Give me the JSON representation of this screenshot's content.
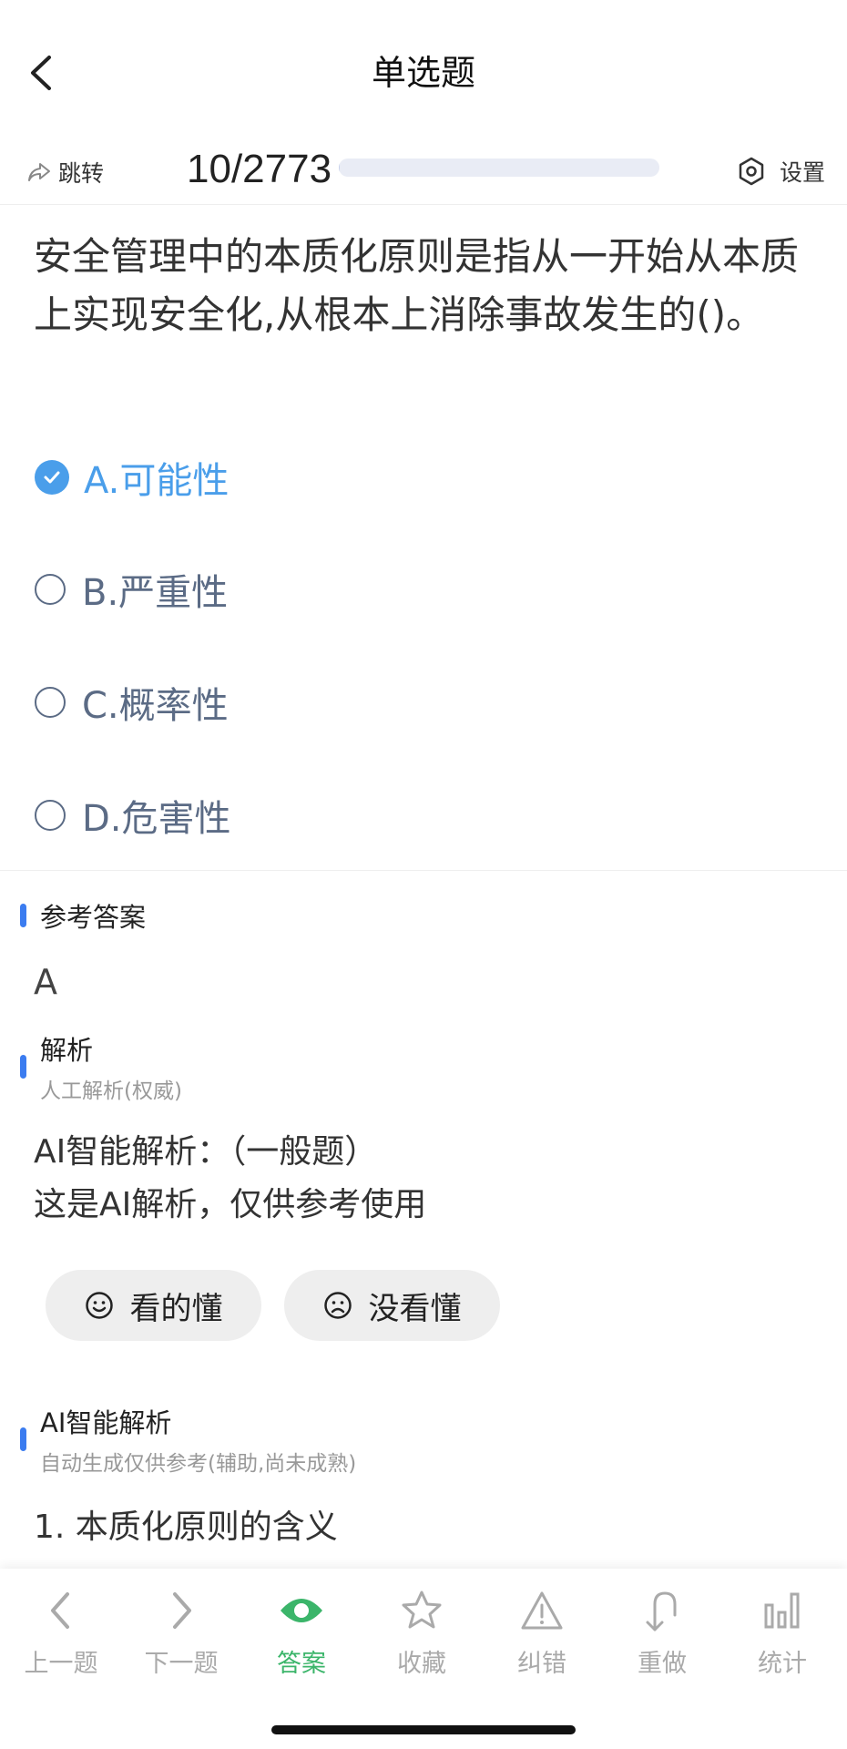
{
  "header": {
    "title": "单选题"
  },
  "progress": {
    "jump_label": "跳转",
    "counter": "10/2773",
    "current": 10,
    "total": 2773,
    "settings_label": "设置"
  },
  "question": {
    "text": "安全管理中的本质化原则是指从一开始从本质上实现安全化,从根本上消除事故发生的()。",
    "options": [
      {
        "label": "A.可能性",
        "selected": true
      },
      {
        "label": "B.严重性",
        "selected": false
      },
      {
        "label": "C.概率性",
        "selected": false
      },
      {
        "label": "D.危害性",
        "selected": false
      }
    ]
  },
  "answer_section": {
    "title": "参考答案",
    "value": "A"
  },
  "analysis_section": {
    "title": "解析",
    "subtitle": "人工解析(权威)",
    "line1": "AI智能解析：（一般题）",
    "line2": "这是AI解析，仅供参考使用"
  },
  "feedback": {
    "understood_label": "看的懂",
    "not_understood_label": "没看懂"
  },
  "ai_section": {
    "title": "AI智能解析",
    "subtitle": "自动生成仅供参考(辅助,尚未成熟)",
    "point1": "1. 本质化原则的含义"
  },
  "tabbar": {
    "items": [
      {
        "label": "上一题",
        "icon": "chevron-left-icon"
      },
      {
        "label": "下一题",
        "icon": "chevron-right-icon"
      },
      {
        "label": "答案",
        "icon": "eye-icon",
        "active": true
      },
      {
        "label": "收藏",
        "icon": "star-icon"
      },
      {
        "label": "纠错",
        "icon": "warning-icon"
      },
      {
        "label": "重做",
        "icon": "undo-icon"
      },
      {
        "label": "统计",
        "icon": "bar-chart-icon"
      }
    ]
  },
  "colors": {
    "accent_blue": "#4a9eea",
    "active_green": "#3bb56a",
    "section_bar": "#3b7cf0"
  }
}
